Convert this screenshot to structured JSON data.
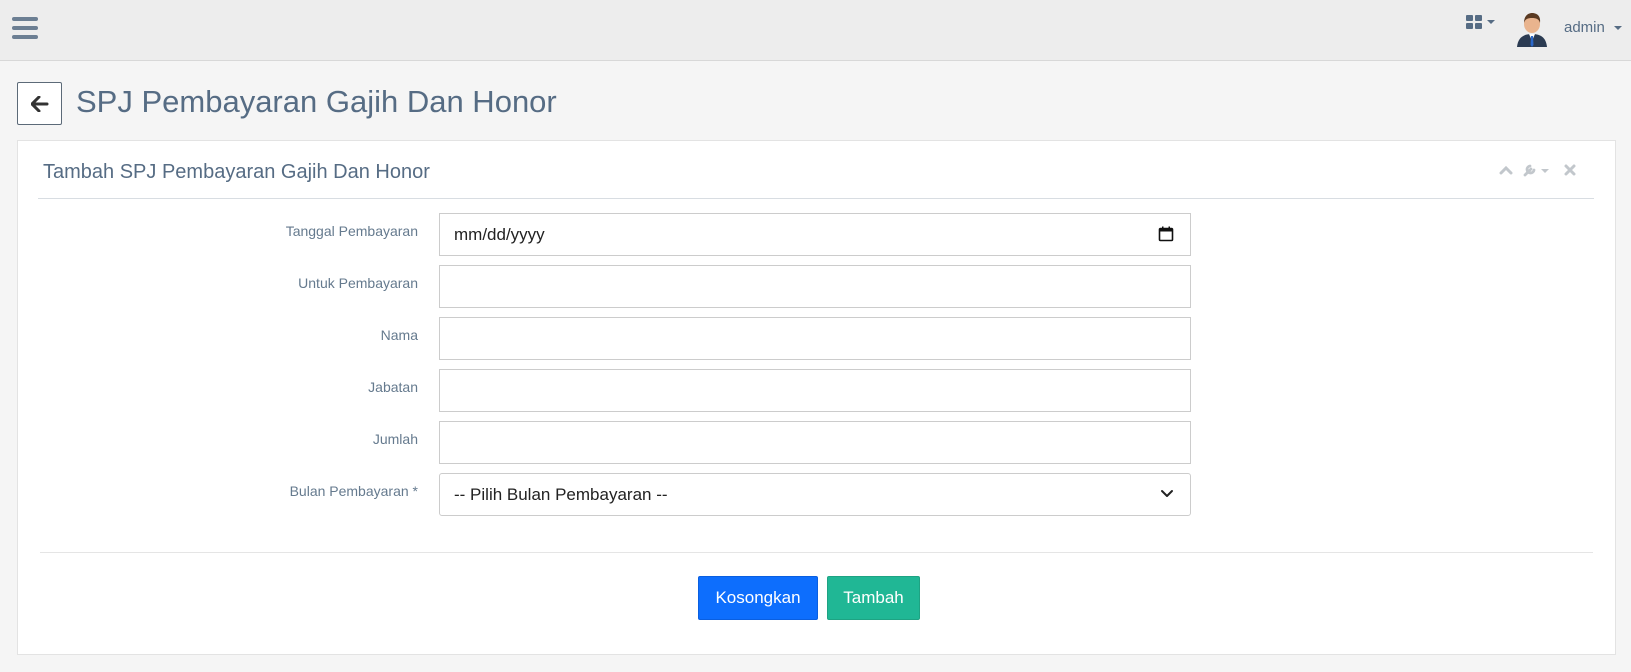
{
  "navbar": {
    "username": "admin",
    "menu_icon": "hamburger-menu-icon",
    "apps_icon": "grid-apps-icon",
    "avatar_icon": "user-avatar"
  },
  "header": {
    "back_icon": "arrow-left-icon",
    "title": "SPJ Pembayaran Gajih Dan Honor"
  },
  "widget": {
    "title": "Tambah SPJ Pembayaran Gajih Dan Honor",
    "tools": [
      "chevron-up-icon",
      "wrench-icon",
      "close-icon"
    ]
  },
  "form": {
    "fields": [
      {
        "label": "Tanggal Pembayaran",
        "type": "date",
        "value": "mm/dd/yyyy"
      },
      {
        "label": "Untuk Pembayaran",
        "type": "text",
        "value": ""
      },
      {
        "label": "Nama",
        "type": "text",
        "value": ""
      },
      {
        "label": "Jabatan",
        "type": "text",
        "value": ""
      },
      {
        "label": "Jumlah",
        "type": "text",
        "value": ""
      },
      {
        "label": "Bulan Pembayaran *",
        "type": "select",
        "value": "-- Pilih Bulan Pembayaran --"
      }
    ]
  },
  "buttons": {
    "reset_label": "Kosongkan",
    "submit_label": "Tambah"
  },
  "colors": {
    "primary": "#0d6efd",
    "success": "#20b795",
    "text": "#566c84"
  }
}
